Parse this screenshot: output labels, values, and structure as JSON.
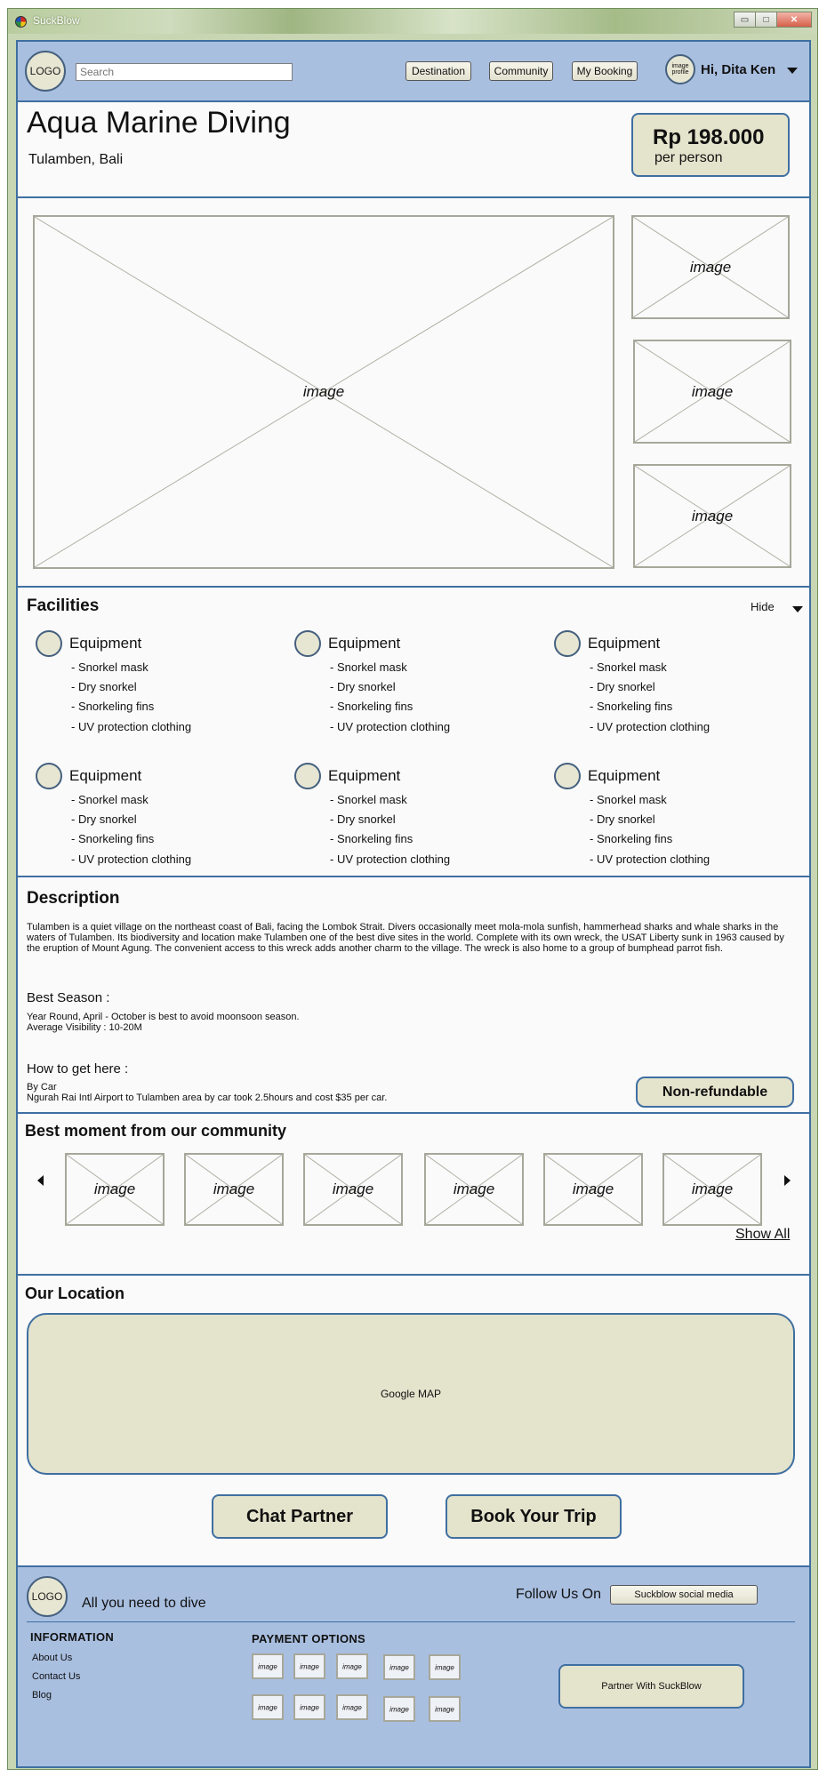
{
  "window": {
    "title": "SuckBlow",
    "min": "▭",
    "max": "□",
    "close": "✕"
  },
  "header": {
    "logo": "LOGO",
    "search_placeholder": "Search",
    "nav": [
      "Destination",
      "Community",
      "My Booking"
    ],
    "avatar": "image profile",
    "greeting": "Hi, Dita Ken"
  },
  "listing": {
    "title": "Aqua Marine Diving",
    "location": "Tulamben, Bali",
    "price": "Rp 198.000",
    "per": "per person"
  },
  "gallery": {
    "label": "image"
  },
  "facilities": {
    "title": "Facilities",
    "toggle": "Hide",
    "items": [
      {
        "title": "Equipment",
        "list": [
          "- Snorkel mask",
          "- Dry snorkel",
          "- Snorkeling fins",
          "- UV protection clothing"
        ]
      },
      {
        "title": "Equipment",
        "list": [
          "- Snorkel mask",
          "- Dry snorkel",
          "- Snorkeling fins",
          "- UV protection clothing"
        ]
      },
      {
        "title": "Equipment",
        "list": [
          "- Snorkel mask",
          "- Dry snorkel",
          "- Snorkeling fins",
          "- UV protection clothing"
        ]
      },
      {
        "title": "Equipment",
        "list": [
          "- Snorkel mask",
          "- Dry snorkel",
          "- Snorkeling fins",
          "- UV protection clothing"
        ]
      },
      {
        "title": "Equipment",
        "list": [
          "- Snorkel mask",
          "- Dry snorkel",
          "- Snorkeling fins",
          "- UV protection clothing"
        ]
      },
      {
        "title": "Equipment",
        "list": [
          "- Snorkel mask",
          "- Dry snorkel",
          "- Snorkeling fins",
          "- UV protection clothing"
        ]
      }
    ]
  },
  "description": {
    "title": "Description",
    "text": "Tulamben is a quiet village on the northeast coast of Bali, facing the Lombok Strait. Divers occasionally meet mola-mola sunfish, hammerhead sharks and whale sharks in the waters of Tulamben. Its biodiversity and location make Tulamben one of the best dive sites in the world. Complete with its own wreck, the USAT Liberty sunk in 1963 caused by the eruption of Mount Agung. The convenient access to this wreck adds another charm to the village. The wreck is also home to a group of bumphead parrot fish.",
    "season_title": "Best Season :",
    "season_1": "Year Round, April - October is best to avoid moonsoon season.",
    "season_2": "Average Visibility : 10-20M",
    "howto_title": "How to get here :",
    "howto_1": "By Car",
    "howto_2": "Ngurah Rai Intl Airport to Tulamben area by car took 2.5hours and cost $35 per car.",
    "refund": "Non-refundable"
  },
  "community": {
    "title": "Best moment from our community",
    "label": "image",
    "show_all": "Show All"
  },
  "location": {
    "title": "Our Location",
    "map": "Google MAP"
  },
  "actions": {
    "chat": "Chat Partner",
    "book": "Book Your Trip"
  },
  "footer": {
    "logo": "LOGO",
    "tagline": "All you need to dive",
    "follow": "Follow Us On",
    "social": "Suckblow social media",
    "info_title": "INFORMATION",
    "links": [
      "About Us",
      "Contact Us",
      "Blog"
    ],
    "payment_title": "PAYMENT OPTIONS",
    "pay_label": "image",
    "partner": "Partner With SuckBlow"
  }
}
